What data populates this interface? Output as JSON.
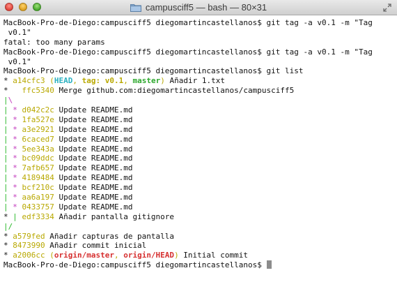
{
  "window": {
    "title": "campusciff5 — bash — 80×31"
  },
  "prompt": "MacBook-Pro-de-Diego:campusciff5 diegomartincastellanos$ ",
  "terminal": {
    "l1": "git tag -a v0.1 -m \"Tag",
    "l2": " v0.1\"",
    "l3": "fatal: too many params",
    "l4": "git tag -a v0.1 -m \"Tag",
    "l5": " v0.1\"",
    "l6": "git list",
    "c1_hash": "a14cfc3",
    "c1_head": "HEAD",
    "c1_tag": "tag: v0.1",
    "c1_branch": "master",
    "c1_msg": " Añadir 1.txt",
    "c2_hash": "ffc5340",
    "c2_msg": " Merge github.com:diegomartincastellanos/campusciff5",
    "b_hashes": [
      "d042c2c",
      "1fa527e",
      "a3e2921",
      "6caced7",
      "5ee343a",
      "bc09ddc",
      "7afb657",
      "4189484",
      "bcf210c",
      "aa6a197",
      "0433757"
    ],
    "b_msg": " Update README.md",
    "c14_hash": "edf3334",
    "c14_msg": " Añadir pantalla gitignore",
    "c15_hash": "a579fed",
    "c15_msg": " Añadir capturas de pantalla",
    "c16_hash": "8473990",
    "c16_msg": " Añadir commit inicial",
    "c17_hash": "a2006cc",
    "c17_r1": "origin/master",
    "c17_r2": "origin/HEAD",
    "c17_msg": " Initial commit"
  },
  "colors": {
    "hash": "#b8a800",
    "graph_green": "#28b828",
    "graph_magenta": "#c23abd",
    "head": "#2ab0c0",
    "branch": "#2ea82e",
    "remote": "#d63030"
  },
  "icons": {
    "title": "folder-icon",
    "fullscreen": "fullscreen-arrows-icon"
  }
}
